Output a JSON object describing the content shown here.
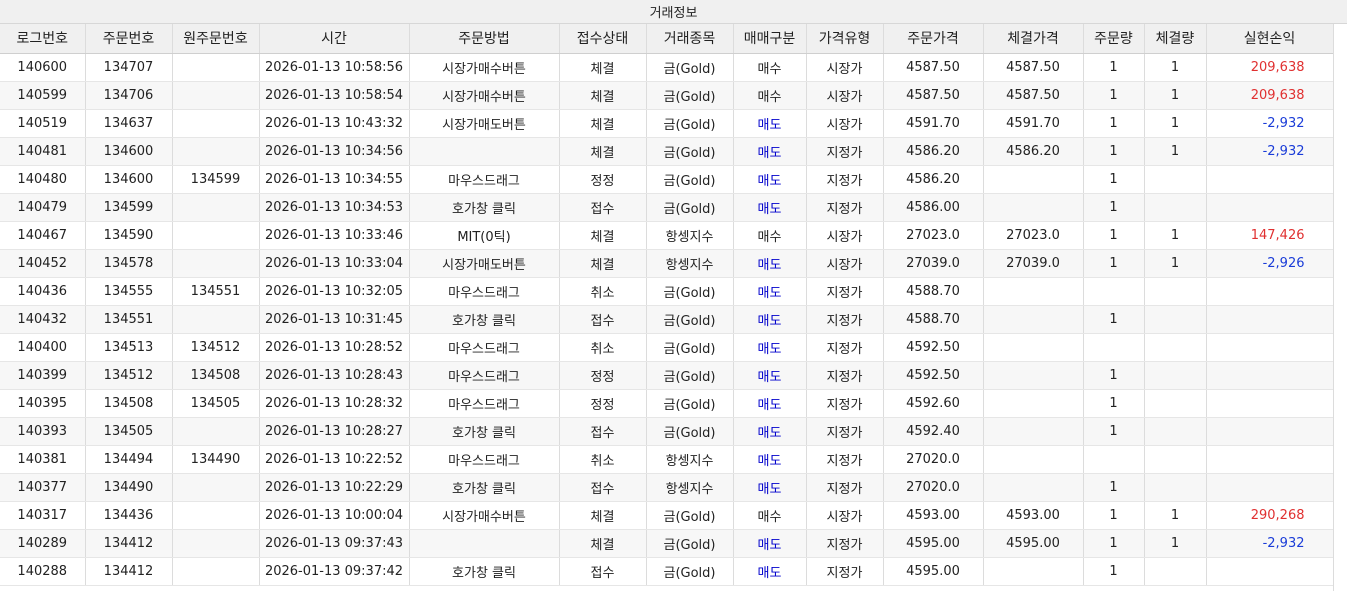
{
  "colors": {
    "buy": "#222222",
    "sell": "#0000cc",
    "profit": "#e03030",
    "loss": "#1a3cd8"
  },
  "group_header": "거래정보",
  "columns": [
    {
      "key": "log",
      "label": "로그번호",
      "width": 85
    },
    {
      "key": "order",
      "label": "주문번호",
      "width": 87
    },
    {
      "key": "orig",
      "label": "원주문번호",
      "width": 87
    },
    {
      "key": "time",
      "label": "시간",
      "width": 150
    },
    {
      "key": "method",
      "label": "주문방법",
      "width": 150
    },
    {
      "key": "status",
      "label": "접수상태",
      "width": 87
    },
    {
      "key": "item",
      "label": "거래종목",
      "width": 87
    },
    {
      "key": "side",
      "label": "매매구분",
      "width": 73
    },
    {
      "key": "ptype",
      "label": "가격유형",
      "width": 77
    },
    {
      "key": "price",
      "label": "주문가격",
      "width": 100
    },
    {
      "key": "fill",
      "label": "체결가격",
      "width": 100
    },
    {
      "key": "qty",
      "label": "주문량",
      "width": 61
    },
    {
      "key": "fillqty",
      "label": "체결량",
      "width": 62
    },
    {
      "key": "pnl",
      "label": "실현손익",
      "width": 127
    }
  ],
  "rows": [
    {
      "log": "140600",
      "order": "134707",
      "orig": "",
      "time": "2026-01-13 10:58:56",
      "method": "시장가매수버튼",
      "status": "체결",
      "item": "금(Gold)",
      "side": "매수",
      "ptype": "시장가",
      "price": "4587.50",
      "fill": "4587.50",
      "qty": "1",
      "fillqty": "1",
      "pnl": "209,638"
    },
    {
      "log": "140599",
      "order": "134706",
      "orig": "",
      "time": "2026-01-13 10:58:54",
      "method": "시장가매수버튼",
      "status": "체결",
      "item": "금(Gold)",
      "side": "매수",
      "ptype": "시장가",
      "price": "4587.50",
      "fill": "4587.50",
      "qty": "1",
      "fillqty": "1",
      "pnl": "209,638"
    },
    {
      "log": "140519",
      "order": "134637",
      "orig": "",
      "time": "2026-01-13 10:43:32",
      "method": "시장가매도버튼",
      "status": "체결",
      "item": "금(Gold)",
      "side": "매도",
      "ptype": "시장가",
      "price": "4591.70",
      "fill": "4591.70",
      "qty": "1",
      "fillqty": "1",
      "pnl": "-2,932"
    },
    {
      "log": "140481",
      "order": "134600",
      "orig": "",
      "time": "2026-01-13 10:34:56",
      "method": "",
      "status": "체결",
      "item": "금(Gold)",
      "side": "매도",
      "ptype": "지정가",
      "price": "4586.20",
      "fill": "4586.20",
      "qty": "1",
      "fillqty": "1",
      "pnl": "-2,932"
    },
    {
      "log": "140480",
      "order": "134600",
      "orig": "134599",
      "time": "2026-01-13 10:34:55",
      "method": "마우스드래그",
      "status": "정정",
      "item": "금(Gold)",
      "side": "매도",
      "ptype": "지정가",
      "price": "4586.20",
      "fill": "",
      "qty": "1",
      "fillqty": "",
      "pnl": ""
    },
    {
      "log": "140479",
      "order": "134599",
      "orig": "",
      "time": "2026-01-13 10:34:53",
      "method": "호가창 클릭",
      "status": "접수",
      "item": "금(Gold)",
      "side": "매도",
      "ptype": "지정가",
      "price": "4586.00",
      "fill": "",
      "qty": "1",
      "fillqty": "",
      "pnl": ""
    },
    {
      "log": "140467",
      "order": "134590",
      "orig": "",
      "time": "2026-01-13 10:33:46",
      "method": "MIT(0틱)",
      "status": "체결",
      "item": "항셍지수",
      "side": "매수",
      "ptype": "시장가",
      "price": "27023.0",
      "fill": "27023.0",
      "qty": "1",
      "fillqty": "1",
      "pnl": "147,426"
    },
    {
      "log": "140452",
      "order": "134578",
      "orig": "",
      "time": "2026-01-13 10:33:04",
      "method": "시장가매도버튼",
      "status": "체결",
      "item": "항셍지수",
      "side": "매도",
      "ptype": "시장가",
      "price": "27039.0",
      "fill": "27039.0",
      "qty": "1",
      "fillqty": "1",
      "pnl": "-2,926"
    },
    {
      "log": "140436",
      "order": "134555",
      "orig": "134551",
      "time": "2026-01-13 10:32:05",
      "method": "마우스드래그",
      "status": "취소",
      "item": "금(Gold)",
      "side": "매도",
      "ptype": "지정가",
      "price": "4588.70",
      "fill": "",
      "qty": "",
      "fillqty": "",
      "pnl": ""
    },
    {
      "log": "140432",
      "order": "134551",
      "orig": "",
      "time": "2026-01-13 10:31:45",
      "method": "호가창 클릭",
      "status": "접수",
      "item": "금(Gold)",
      "side": "매도",
      "ptype": "지정가",
      "price": "4588.70",
      "fill": "",
      "qty": "1",
      "fillqty": "",
      "pnl": ""
    },
    {
      "log": "140400",
      "order": "134513",
      "orig": "134512",
      "time": "2026-01-13 10:28:52",
      "method": "마우스드래그",
      "status": "취소",
      "item": "금(Gold)",
      "side": "매도",
      "ptype": "지정가",
      "price": "4592.50",
      "fill": "",
      "qty": "",
      "fillqty": "",
      "pnl": ""
    },
    {
      "log": "140399",
      "order": "134512",
      "orig": "134508",
      "time": "2026-01-13 10:28:43",
      "method": "마우스드래그",
      "status": "정정",
      "item": "금(Gold)",
      "side": "매도",
      "ptype": "지정가",
      "price": "4592.50",
      "fill": "",
      "qty": "1",
      "fillqty": "",
      "pnl": ""
    },
    {
      "log": "140395",
      "order": "134508",
      "orig": "134505",
      "time": "2026-01-13 10:28:32",
      "method": "마우스드래그",
      "status": "정정",
      "item": "금(Gold)",
      "side": "매도",
      "ptype": "지정가",
      "price": "4592.60",
      "fill": "",
      "qty": "1",
      "fillqty": "",
      "pnl": ""
    },
    {
      "log": "140393",
      "order": "134505",
      "orig": "",
      "time": "2026-01-13 10:28:27",
      "method": "호가창 클릭",
      "status": "접수",
      "item": "금(Gold)",
      "side": "매도",
      "ptype": "지정가",
      "price": "4592.40",
      "fill": "",
      "qty": "1",
      "fillqty": "",
      "pnl": ""
    },
    {
      "log": "140381",
      "order": "134494",
      "orig": "134490",
      "time": "2026-01-13 10:22:52",
      "method": "마우스드래그",
      "status": "취소",
      "item": "항셍지수",
      "side": "매도",
      "ptype": "지정가",
      "price": "27020.0",
      "fill": "",
      "qty": "",
      "fillqty": "",
      "pnl": ""
    },
    {
      "log": "140377",
      "order": "134490",
      "orig": "",
      "time": "2026-01-13 10:22:29",
      "method": "호가창 클릭",
      "status": "접수",
      "item": "항셍지수",
      "side": "매도",
      "ptype": "지정가",
      "price": "27020.0",
      "fill": "",
      "qty": "1",
      "fillqty": "",
      "pnl": ""
    },
    {
      "log": "140317",
      "order": "134436",
      "orig": "",
      "time": "2026-01-13 10:00:04",
      "method": "시장가매수버튼",
      "status": "체결",
      "item": "금(Gold)",
      "side": "매수",
      "ptype": "시장가",
      "price": "4593.00",
      "fill": "4593.00",
      "qty": "1",
      "fillqty": "1",
      "pnl": "290,268"
    },
    {
      "log": "140289",
      "order": "134412",
      "orig": "",
      "time": "2026-01-13 09:37:43",
      "method": "",
      "status": "체결",
      "item": "금(Gold)",
      "side": "매도",
      "ptype": "지정가",
      "price": "4595.00",
      "fill": "4595.00",
      "qty": "1",
      "fillqty": "1",
      "pnl": "-2,932"
    },
    {
      "log": "140288",
      "order": "134412",
      "orig": "",
      "time": "2026-01-13 09:37:42",
      "method": "호가창 클릭",
      "status": "접수",
      "item": "금(Gold)",
      "side": "매도",
      "ptype": "지정가",
      "price": "4595.00",
      "fill": "",
      "qty": "1",
      "fillqty": "",
      "pnl": ""
    }
  ]
}
